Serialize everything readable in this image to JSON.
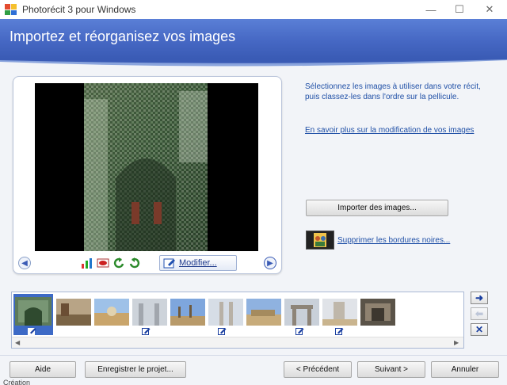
{
  "window": {
    "title": "Photorécit 3 pour Windows",
    "controls": {
      "minimize": "—",
      "maximize": "☐",
      "close": "✕"
    }
  },
  "header": {
    "title": "Importez et réorganisez vos images"
  },
  "preview": {
    "modify_label": "Modifier...",
    "tools": [
      "auto-correct-icon",
      "red-eye-icon",
      "rotate-left-icon",
      "rotate-right-icon",
      "edit-icon"
    ]
  },
  "instructions": {
    "text": "Sélectionnez les images à utiliser dans votre récit, puis classez-les dans l'ordre sur la pellicule.",
    "learn_more": "En savoir plus sur la modification de vos images"
  },
  "actions": {
    "import_label": "Importer des images...",
    "remove_borders_label": "Supprimer les bordures noires..."
  },
  "filmstrip": {
    "count": 10,
    "selected_index": 0
  },
  "footer": {
    "help": "Aide",
    "save_project": "Enregistrer le projet...",
    "previous": "< Précédent",
    "next": "Suivant >",
    "cancel": "Annuler"
  },
  "status": {
    "text": "Création"
  },
  "colors": {
    "accent": "#4668c4",
    "link": "#1f4fa6",
    "selection": "#3d6ac6"
  }
}
